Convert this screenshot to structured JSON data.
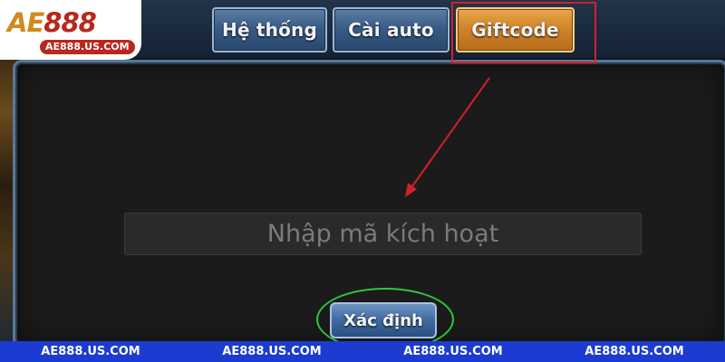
{
  "logo": {
    "brand_letters": "AE",
    "brand_number": "888",
    "url": "AE888.US.COM"
  },
  "tabs": [
    {
      "label": "Hệ thống",
      "active": false
    },
    {
      "label": "Cài auto",
      "active": false
    },
    {
      "label": "Giftcode",
      "active": true
    }
  ],
  "giftcode": {
    "placeholder": "Nhập mã kích hoạt",
    "value": ""
  },
  "confirm_button": {
    "label": "Xác định"
  },
  "footer": {
    "watermarks": [
      "AE888.US.COM",
      "AE888.US.COM",
      "AE888.US.COM",
      "AE888.US.COM"
    ]
  },
  "colors": {
    "active_tab": "#cf8127",
    "inactive_tab": "#3a5c86",
    "highlight_box": "#d3202a",
    "highlight_ellipse": "#2fc63a",
    "footer_bar": "#1c3bd0"
  },
  "icons": {
    "annotation": "red-arrow-icon"
  }
}
